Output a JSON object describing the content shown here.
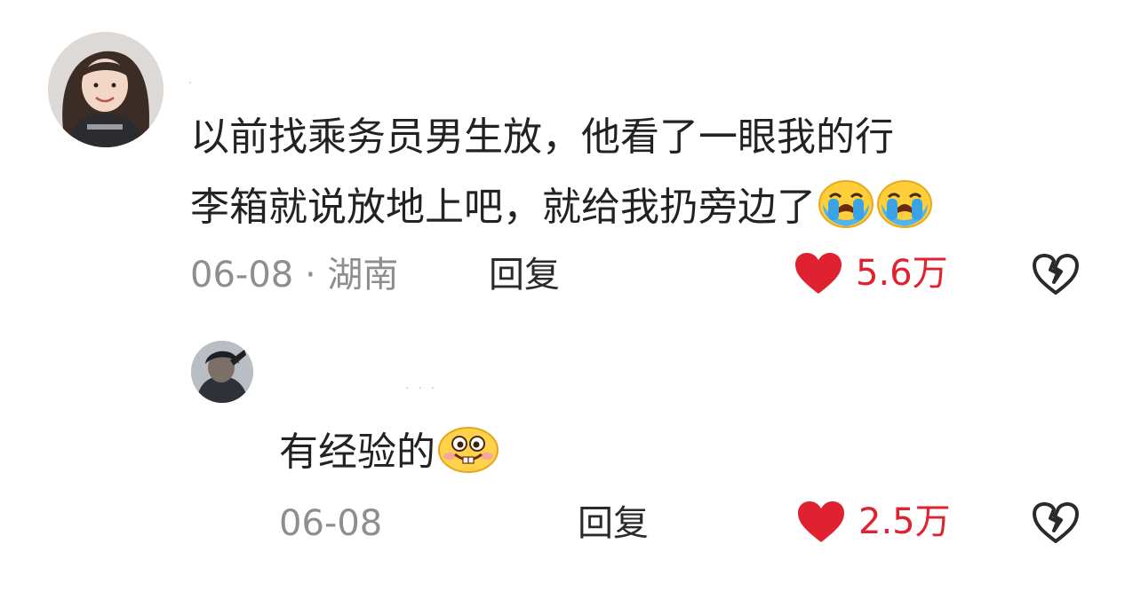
{
  "comments": [
    {
      "text_line1": "以前找乘务员男生放，他看了一眼我的行",
      "text_line2": "李箱就说放地上吧，就给我扔旁边了",
      "emojis": [
        "crying-emoji",
        "crying-emoji"
      ],
      "date": "06-08",
      "location": "湖南",
      "reply_label": "回复",
      "likes": "5.6万"
    },
    {
      "text": "有经验的",
      "emojis": [
        "buck-teeth-grin-emoji"
      ],
      "date": "06-08",
      "reply_label": "回复",
      "likes": "2.5万"
    }
  ],
  "colors": {
    "like_red": "#e02230",
    "meta_gray": "#8e8e8e",
    "text_dark": "#222222"
  }
}
